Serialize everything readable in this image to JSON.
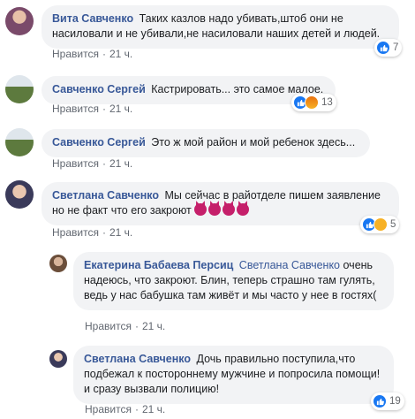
{
  "comments": [
    {
      "author": "Вита Савченко",
      "text": "Таких казлов надо убивать,штоб они не насиловали и не убивали,не насиловали наших детей и людей.",
      "like_label": "Нравится",
      "time": "21 ч.",
      "reaction_count": "7",
      "reactions": [
        "like-icon"
      ]
    },
    {
      "author": "Савченко Сергей",
      "text": "Кастрировать... это самое малое.",
      "like_label": "Нравится",
      "time": "21 ч.",
      "reaction_count": "13",
      "reactions": [
        "like-icon",
        "angry-icon"
      ]
    },
    {
      "author": "Савченко Сергей",
      "text": "Это ж мой район и мой ребенок здесь...",
      "like_label": "Нравится",
      "time": "21 ч."
    },
    {
      "author": "Светлана Савченко",
      "text": "Мы сейчас в райотделе пишем заявление но не факт что его закроют",
      "like_label": "Нравится",
      "time": "21 ч.",
      "reaction_count": "5",
      "reactions": [
        "like-icon",
        "sad-icon"
      ],
      "emoji": [
        "devil-emoji",
        "devil-emoji",
        "devil-emoji",
        "devil-emoji"
      ]
    },
    {
      "author": "Екатерина Бабаева Персиц",
      "tag": "Светлана Савченко",
      "text": "очень надеюсь, что закроют. Блин, теперь страшно там гулять, ведь у нас бабушка там живёт и мы часто у нее в гостях(",
      "like_label": "Нравится",
      "time": "21 ч."
    },
    {
      "author": "Светлана Савченко",
      "text": "Дочь правильно поступила,что подбежал к постороннему мужчине и попросила помощи!и сразу вызвали полицию!",
      "like_label": "Нравится",
      "time": "21 ч.",
      "reaction_count": "19",
      "reactions": [
        "like-icon"
      ]
    }
  ],
  "separator": "·"
}
